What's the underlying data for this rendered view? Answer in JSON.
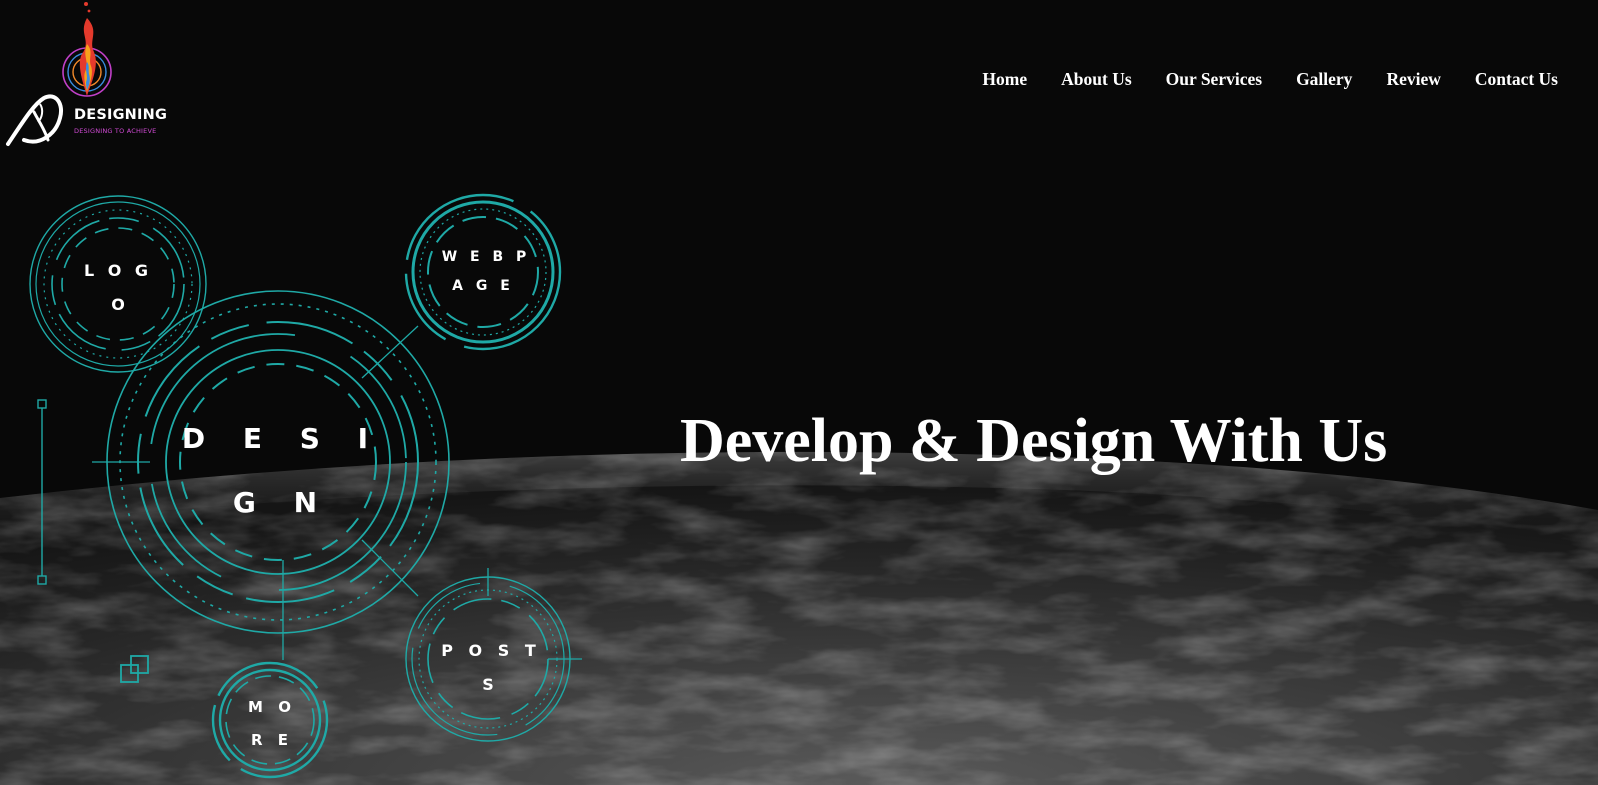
{
  "brand": {
    "name": "DESIGNING",
    "tagline": "DESIGNING TO ACHIEVE"
  },
  "nav": {
    "items": [
      "Home",
      "About Us",
      "Our Services",
      "Gallery",
      "Review",
      "Contact Us"
    ]
  },
  "hero": {
    "title": "Develop & Design With Us"
  },
  "circles": {
    "logo": [
      "L O G",
      "O"
    ],
    "webpage": [
      "W E B P",
      "A G E"
    ],
    "design": [
      "D E S I",
      "G N"
    ],
    "posts": [
      "P O S T",
      "S"
    ],
    "more": [
      "M O",
      "R E"
    ]
  },
  "colors": {
    "accent": "#1fa9a6",
    "background": "#080808",
    "text": "#ffffff",
    "tagline": "#d24bd6"
  },
  "icons": {
    "logo": "flame-logo-icon",
    "slider": "vertical-slider-icon",
    "squares": "overlapping-squares-icon"
  }
}
